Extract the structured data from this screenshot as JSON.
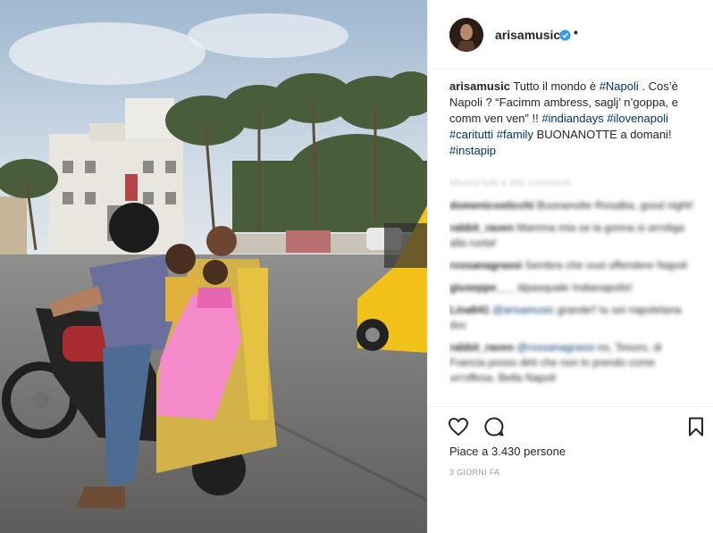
{
  "post": {
    "username": "arisamusic",
    "header_separator": "•",
    "caption_user": "arisamusic",
    "caption_parts": [
      {
        "text": "Tutto il mondo è ",
        "tag": false
      },
      {
        "text": "#Napoli",
        "tag": true
      },
      {
        "text": " . Cos’è Napoli ? “Facimm ambress, saglj’ n’goppa, e comm ven ven” !! ",
        "tag": false
      },
      {
        "text": "#indiandays",
        "tag": true
      },
      {
        "text": " ",
        "tag": false
      },
      {
        "text": "#ilovenapoli",
        "tag": true
      },
      {
        "text": " ",
        "tag": false
      },
      {
        "text": "#caritutti",
        "tag": true
      },
      {
        "text": " ",
        "tag": false
      },
      {
        "text": "#family",
        "tag": true
      },
      {
        "text": " BUONANOTTE a domani! ",
        "tag": false
      },
      {
        "text": "#instapip",
        "tag": true
      }
    ],
    "view_all": "Mostra tutti e 391 commenti",
    "comments": [
      {
        "user": "domenicosticchi",
        "text": "Buonanotte Rosalba, good night!"
      },
      {
        "user": "rabbit_raven",
        "text": "Mamma mia se la gonna si arrotiga alla ruota!"
      },
      {
        "user": "rossanagrassi",
        "text": "Sembra che vuoi offendere Napoli"
      },
      {
        "user": "giuseppe___",
        "text": "dipasquale Indianapolis!"
      },
      {
        "user": "Lina641",
        "mention": "@arisamusic",
        "text": "grande!! tu sei napoletana doc"
      },
      {
        "user": "rabbit_raven",
        "mention": "@rossanagrassi",
        "text": "no, Tesoro, di Francia posso dirti che non lo prendo come un'offesa. Bella Napoli"
      }
    ],
    "likes": "Piace a 3.430 persone",
    "date": "3 GIORNI FA"
  },
  "icons": {
    "like": "heart-icon",
    "comment": "comment-bubble-icon",
    "save": "bookmark-icon",
    "verified": "verified-badge-icon"
  },
  "colors": {
    "hashtag": "#003569",
    "verified": "#3897f0",
    "text": "#262626",
    "muted": "#999999"
  }
}
